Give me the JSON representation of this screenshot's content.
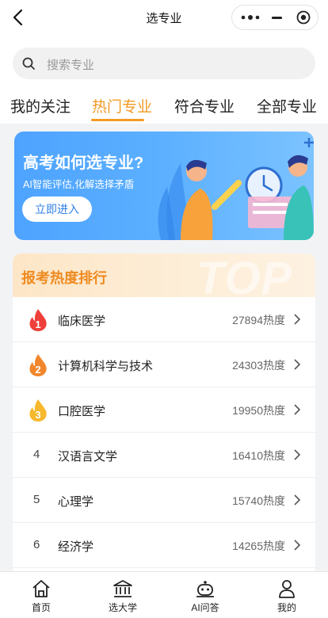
{
  "header": {
    "title": "选专业"
  },
  "search": {
    "placeholder": "搜索专业"
  },
  "tabs": [
    {
      "label": "我的关注"
    },
    {
      "label": "热门专业",
      "active": true
    },
    {
      "label": "符合专业"
    },
    {
      "label": "全部专业"
    }
  ],
  "banner": {
    "title": "高考如何选专业?",
    "subtitle": "AI智能评估,化解选择矛盾",
    "button": "立即进入"
  },
  "ranking": {
    "title": "报考热度排行",
    "watermark": "TOP",
    "items": [
      {
        "rank": "1",
        "name": "临床医学",
        "heat": "27894热度"
      },
      {
        "rank": "2",
        "name": "计算机科学与技术",
        "heat": "24303热度"
      },
      {
        "rank": "3",
        "name": "口腔医学",
        "heat": "19950热度"
      },
      {
        "rank": "4",
        "name": "汉语言文学",
        "heat": "16410热度"
      },
      {
        "rank": "5",
        "name": "心理学",
        "heat": "15740热度"
      },
      {
        "rank": "6",
        "name": "经济学",
        "heat": "14265热度"
      }
    ]
  },
  "bottom_nav": [
    {
      "label": "首页",
      "icon": "home-icon"
    },
    {
      "label": "选大学",
      "icon": "university-icon"
    },
    {
      "label": "AI问答",
      "icon": "robot-icon"
    },
    {
      "label": "我的",
      "icon": "user-icon"
    }
  ],
  "colors": {
    "accent": "#f39a25",
    "banner": "#4da3ff",
    "rank_title": "#ee8a20"
  }
}
